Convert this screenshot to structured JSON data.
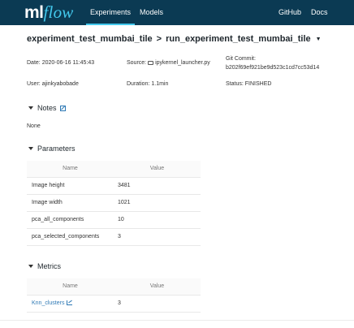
{
  "nav": {
    "logo_ml": "ml",
    "logo_flow": "flow",
    "experiments": "Experiments",
    "models": "Models",
    "github": "GitHub",
    "docs": "Docs"
  },
  "breadcrumb": {
    "experiment": "experiment_test_mumbai_tile",
    "separator": ">",
    "run": "run_experiment_test_mumbai_tile",
    "caret": "▼"
  },
  "meta": {
    "date_label": "Date:",
    "date_value": "2020-06-16 11:45:43",
    "source_label": "Source:",
    "source_value": "ipykernel_launcher.py",
    "git_label": "Git Commit:",
    "git_value": "b202f69ef921be9d523c1cd7cc53d14",
    "user_label": "User:",
    "user_value": "ajinkyabobade",
    "duration_label": "Duration:",
    "duration_value": "1.1min",
    "status_label": "Status:",
    "status_value": "FINISHED"
  },
  "notes": {
    "title": "Notes",
    "body": "None"
  },
  "parameters": {
    "title": "Parameters",
    "headers": [
      "Name",
      "Value"
    ],
    "rows": [
      {
        "name": "Image height",
        "value": "3481"
      },
      {
        "name": "Image width",
        "value": "1021"
      },
      {
        "name": "pca_all_components",
        "value": "10"
      },
      {
        "name": "pca_selected_components",
        "value": "3"
      }
    ]
  },
  "metrics": {
    "title": "Metrics",
    "headers": [
      "Name",
      "Value"
    ],
    "rows": [
      {
        "name": "Knn_clusters",
        "value": "3"
      }
    ]
  },
  "colors": {
    "nav_bg": "#0b3a53",
    "accent": "#43c9ed",
    "link": "#2e79b5"
  }
}
